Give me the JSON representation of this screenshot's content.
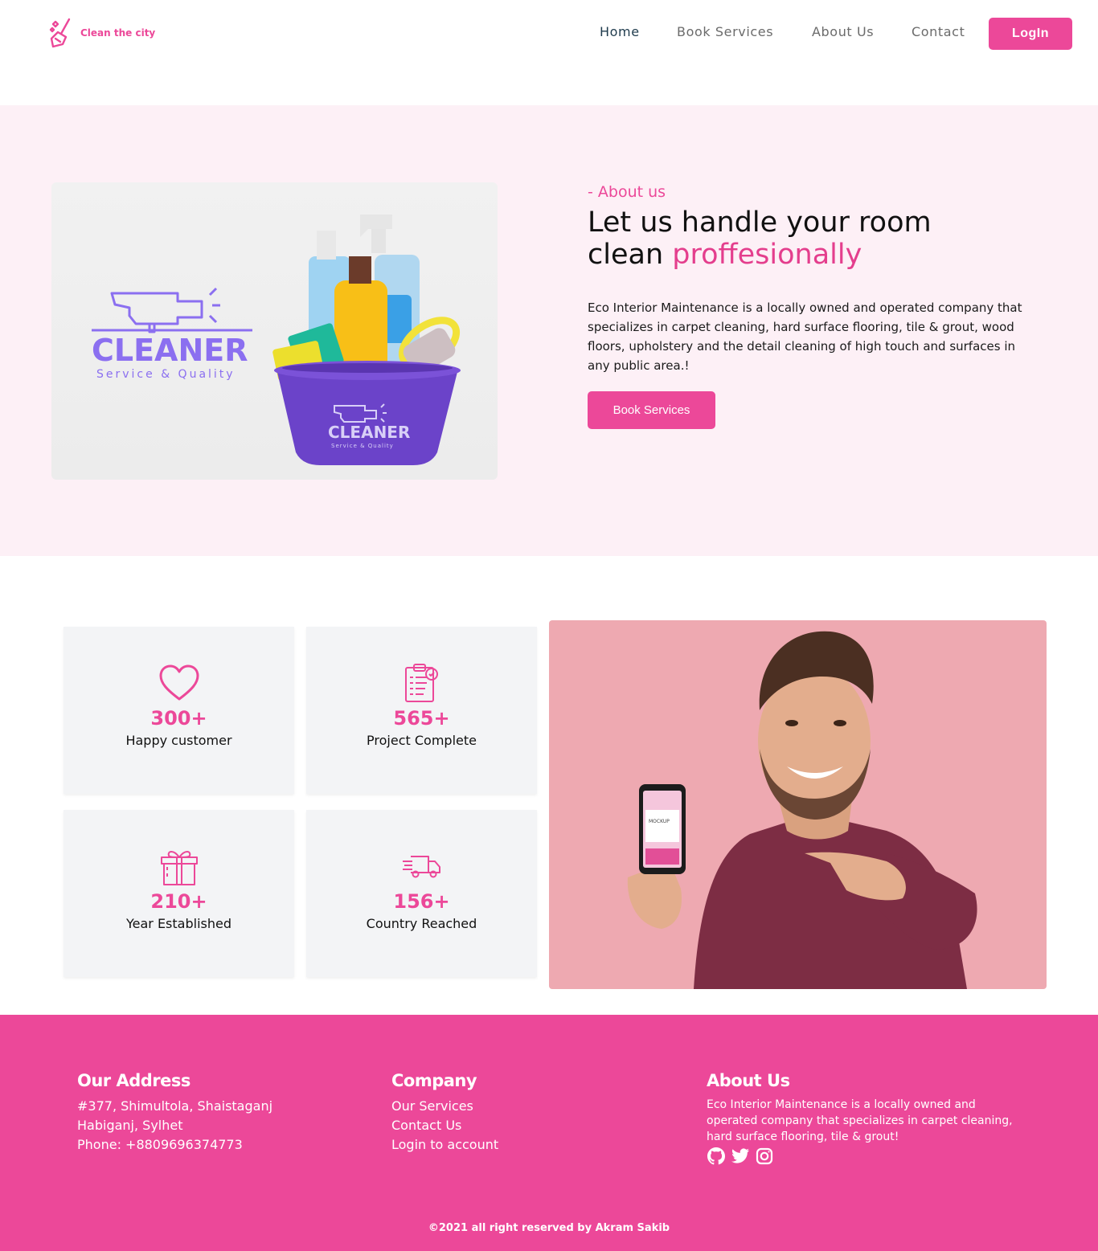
{
  "brand": {
    "name": "Clean the city",
    "accent": "#ec4899",
    "hero_bg": "#fdf0f6",
    "panel_bg": "#eea9b1"
  },
  "nav": {
    "items": [
      {
        "label": "Home",
        "active": true
      },
      {
        "label": "Book Services",
        "active": false
      },
      {
        "label": "About Us",
        "active": false
      },
      {
        "label": "Contact",
        "active": false
      }
    ],
    "login_label": "LogIn"
  },
  "hero": {
    "kicker": "- About us",
    "title_line1": "Let us handle your room",
    "title_line2_plain": "clean",
    "title_line2_accent": "proffesionally",
    "body": "Eco Interior Maintenance is a locally owned and operated company that specializes in carpet cleaning, hard surface flooring, tile & grout, wood floors, upholstery and the detail cleaning of high touch and surfaces in any public area.!",
    "button_label": "Book Services",
    "image": {
      "logo_word": "CLEANER",
      "logo_tagline": "Service & Quality",
      "bowl_word": "CLEANER",
      "bowl_tagline": "Service & Quality"
    }
  },
  "stats": [
    {
      "icon": "heart-icon",
      "value": "300+",
      "label": "Happy customer"
    },
    {
      "icon": "clipboard-checklist-icon",
      "value": "565+",
      "label": "Project Complete"
    },
    {
      "icon": "gift-icon",
      "value": "210+",
      "label": "Year Established"
    },
    {
      "icon": "delivery-truck-icon",
      "value": "156+",
      "label": "Country Reached"
    }
  ],
  "phone_mockup_text": "MOCKUP",
  "footer": {
    "address": {
      "heading": "Our Address",
      "line1": "#377, Shimultola, Shaistaganj",
      "line2": "Habiganj, Sylhet",
      "phone": "Phone: +8809696374773"
    },
    "company": {
      "heading": "Company",
      "links": [
        "Our Services",
        "Contact Us",
        "Login to account"
      ]
    },
    "about": {
      "heading": "About Us",
      "text": "Eco Interior Maintenance is a locally owned and operated company that specializes in carpet cleaning, hard surface flooring, tile & grout!",
      "social": [
        "github-icon",
        "twitter-icon",
        "instagram-icon"
      ]
    },
    "copyright": "©2021 all right reserved by Akram Sakib"
  }
}
